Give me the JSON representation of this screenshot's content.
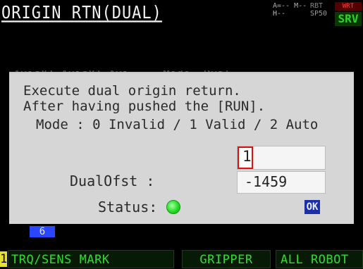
{
  "header": {
    "title": "ORIGIN RTN(DUAL)",
    "status_row1": "A=-- M--",
    "status_row2": "H--",
    "indicator1": "RBT",
    "indicator2": "SP50",
    "write_label": "WRT",
    "servo_label": "SRV"
  },
  "background_text": "  AxisX1 AxisY1 Axi...  Mode  Dual  ...",
  "dialog": {
    "line1": "Execute dual origin return.",
    "line2": "After having pushed the [RUN].",
    "line3": "Mode : 0 Invalid / 1 Valid / 2 Auto",
    "mode_value": "1",
    "dual_ofst_label": "DualOfst :",
    "dual_ofst_value": "-1459",
    "status_label": "Status:",
    "status_color": "#22dd22",
    "ok_label": "OK"
  },
  "page_tab": "6",
  "function_keys": {
    "number": "1",
    "f1": "TRQ/SENS MARK",
    "f2": "GRIPPER",
    "f3": "ALL ROBOT"
  }
}
